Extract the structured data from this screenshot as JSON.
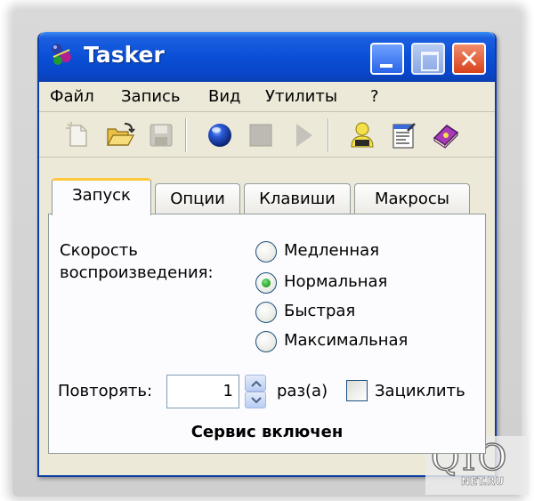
{
  "window": {
    "title": "Tasker",
    "icon": "tasker-app-icon"
  },
  "title_buttons": {
    "minimize_icon": "minimize-icon",
    "maximize_icon": "maximize-icon",
    "close_label": "✕"
  },
  "menu": {
    "items": [
      "Файл",
      "Запись",
      "Вид",
      "Утилиты",
      "?"
    ]
  },
  "toolbar": {
    "icons": [
      "new-icon",
      "open-folder-icon",
      "save-icon",
      "record-icon",
      "stop-icon",
      "play-icon",
      "user-icon",
      "properties-icon",
      "book-icon"
    ]
  },
  "tabs": [
    {
      "label": "Запуск",
      "active": true
    },
    {
      "label": "Опции",
      "active": false
    },
    {
      "label": "Клавиши",
      "active": false
    },
    {
      "label": "Макросы",
      "active": false
    }
  ],
  "panel": {
    "speed_label_line1": "Скорость",
    "speed_label_line2": "воспроизведения:",
    "speed_options": [
      {
        "label": "Медленная",
        "checked": false
      },
      {
        "label": "Нормальная",
        "checked": true
      },
      {
        "label": "Быстрая",
        "checked": false
      },
      {
        "label": "Максимальная",
        "checked": false
      }
    ],
    "repeat_label": "Повторять:",
    "repeat_value": "1",
    "times_label": "раз(а)",
    "loop_label": "Зациклить",
    "loop_checked": false,
    "status": "Сервис включен"
  },
  "watermark": {
    "main": "QIO",
    "sub": "NET.RU"
  },
  "colors": {
    "titlebar": "#0a4fd6",
    "close": "#d8421c",
    "tab_highlight": "#ffc83c",
    "radio_dot": "#21a121"
  }
}
